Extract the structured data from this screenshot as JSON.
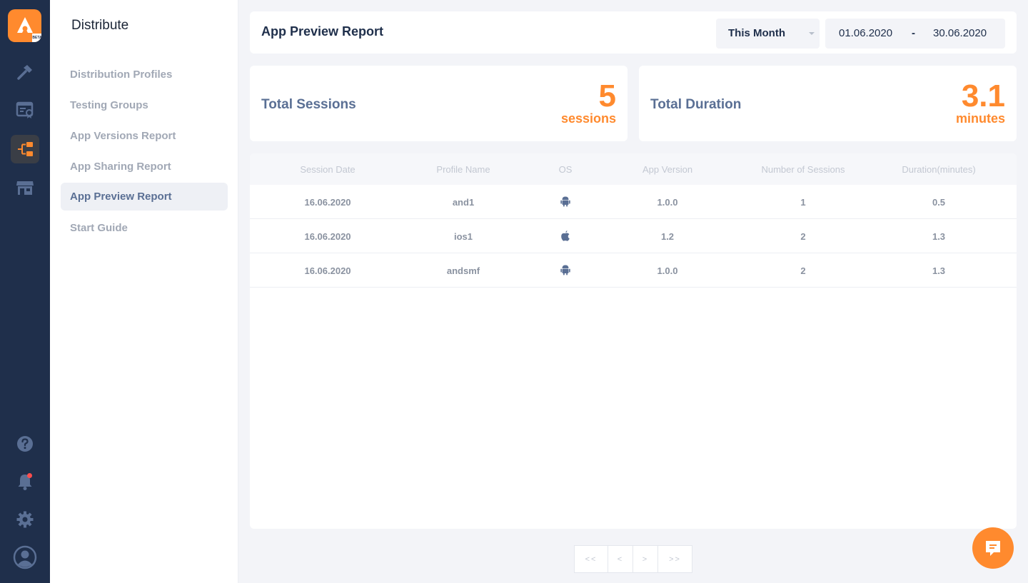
{
  "brand": {
    "logo_icon": "appcircle-logo-icon",
    "badge": "BETA",
    "accent_color": "#ff8a2e",
    "rail_color": "#1f2f4b"
  },
  "rail": {
    "items": [
      {
        "icon": "hammer-icon",
        "active": false
      },
      {
        "icon": "certificate-icon",
        "active": false
      },
      {
        "icon": "distribute-icon",
        "active": true
      },
      {
        "icon": "store-icon",
        "active": false
      }
    ],
    "bottom": [
      {
        "icon": "help-icon"
      },
      {
        "icon": "bell-icon",
        "has_notification": true
      },
      {
        "icon": "gear-icon"
      },
      {
        "icon": "user-avatar-icon"
      }
    ]
  },
  "subnav": {
    "title": "Distribute",
    "items": [
      {
        "label": "Distribution Profiles",
        "active": false
      },
      {
        "label": "Testing Groups",
        "active": false
      },
      {
        "label": "App Versions Report",
        "active": false
      },
      {
        "label": "App Sharing Report",
        "active": false
      },
      {
        "label": "App Preview Report",
        "active": true
      },
      {
        "label": "Start Guide",
        "active": false
      }
    ]
  },
  "header": {
    "title": "App Preview Report",
    "period": "This Month",
    "date_from": "01.06.2020",
    "date_separator": "-",
    "date_to": "30.06.2020"
  },
  "stats": {
    "sessions": {
      "label": "Total Sessions",
      "value": "5",
      "unit": "sessions"
    },
    "duration": {
      "label": "Total Duration",
      "value": "3.1",
      "unit": "minutes"
    }
  },
  "table": {
    "columns": [
      "Session Date",
      "Profile Name",
      "OS",
      "App Version",
      "Number of Sessions",
      "Duration(minutes)"
    ],
    "rows": [
      {
        "date": "16.06.2020",
        "profile": "and1",
        "os": "android-icon",
        "version": "1.0.0",
        "sessions": "1",
        "duration": "0.5"
      },
      {
        "date": "16.06.2020",
        "profile": "ios1",
        "os": "apple-icon",
        "version": "1.2",
        "sessions": "2",
        "duration": "1.3"
      },
      {
        "date": "16.06.2020",
        "profile": "andsmf",
        "os": "android-icon",
        "version": "1.0.0",
        "sessions": "2",
        "duration": "1.3"
      }
    ]
  },
  "pagination": {
    "first": "<<",
    "prev": "<",
    "next": ">",
    "last": ">>"
  },
  "chat": {
    "icon": "chat-icon"
  }
}
